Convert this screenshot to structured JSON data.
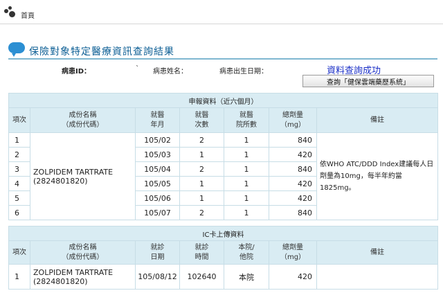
{
  "topbar": {
    "home_label": "首頁"
  },
  "page": {
    "title": "保險對象特定醫療資訊查詢結果"
  },
  "patient": {
    "id_label": "病患ID：",
    "id_mark": "`",
    "name_label": "病患姓名：",
    "birth_label": "病患出生日期："
  },
  "status": {
    "success_text": "資料查詢成功"
  },
  "query_button": {
    "label": "查詢「健保雲端藥歷系統」"
  },
  "claims": {
    "caption": "申報資料（近六個月）",
    "headers": {
      "idx": "項次",
      "ingredient": [
        "成份名稱",
        "（成份代碼）"
      ],
      "month": [
        "就醫",
        "年月"
      ],
      "visits": [
        "就醫",
        "次數"
      ],
      "hospitals": [
        "就醫",
        "院所數"
      ],
      "dose": [
        "總劑量",
        "（mg）"
      ],
      "note": "備註"
    },
    "ingredient": [
      "ZOLPIDEM TARTRATE",
      "(2824801820)"
    ],
    "note": [
      "依WHO ATC/DDD Index建議每人日",
      "劑量為10mg，每半年約當1825mg。"
    ],
    "rows": [
      {
        "idx": "1",
        "month": "105/02",
        "visits": "2",
        "hospitals": "1",
        "dose": "840"
      },
      {
        "idx": "2",
        "month": "105/03",
        "visits": "1",
        "hospitals": "1",
        "dose": "420"
      },
      {
        "idx": "3",
        "month": "105/04",
        "visits": "2",
        "hospitals": "1",
        "dose": "840"
      },
      {
        "idx": "4",
        "month": "105/05",
        "visits": "1",
        "hospitals": "1",
        "dose": "420"
      },
      {
        "idx": "5",
        "month": "105/06",
        "visits": "1",
        "hospitals": "1",
        "dose": "420"
      },
      {
        "idx": "6",
        "month": "105/07",
        "visits": "2",
        "hospitals": "1",
        "dose": "840"
      }
    ]
  },
  "ic_card": {
    "caption": "IC卡上傳資料",
    "headers": {
      "idx": "項次",
      "ingredient": [
        "成份名稱",
        "（成份代碼）"
      ],
      "date": [
        "就診",
        "日期"
      ],
      "time": [
        "就診",
        "時間"
      ],
      "site": [
        "本院/",
        "他院"
      ],
      "dose": [
        "總劑量",
        "（mg）"
      ],
      "note": "備註"
    },
    "rows": [
      {
        "idx": "1",
        "ingredient": [
          "ZOLPIDEM TARTRATE",
          "(2824801820)"
        ],
        "date": "105/08/12",
        "time": "102640",
        "site": "本院",
        "dose": "420",
        "note": ""
      }
    ]
  }
}
